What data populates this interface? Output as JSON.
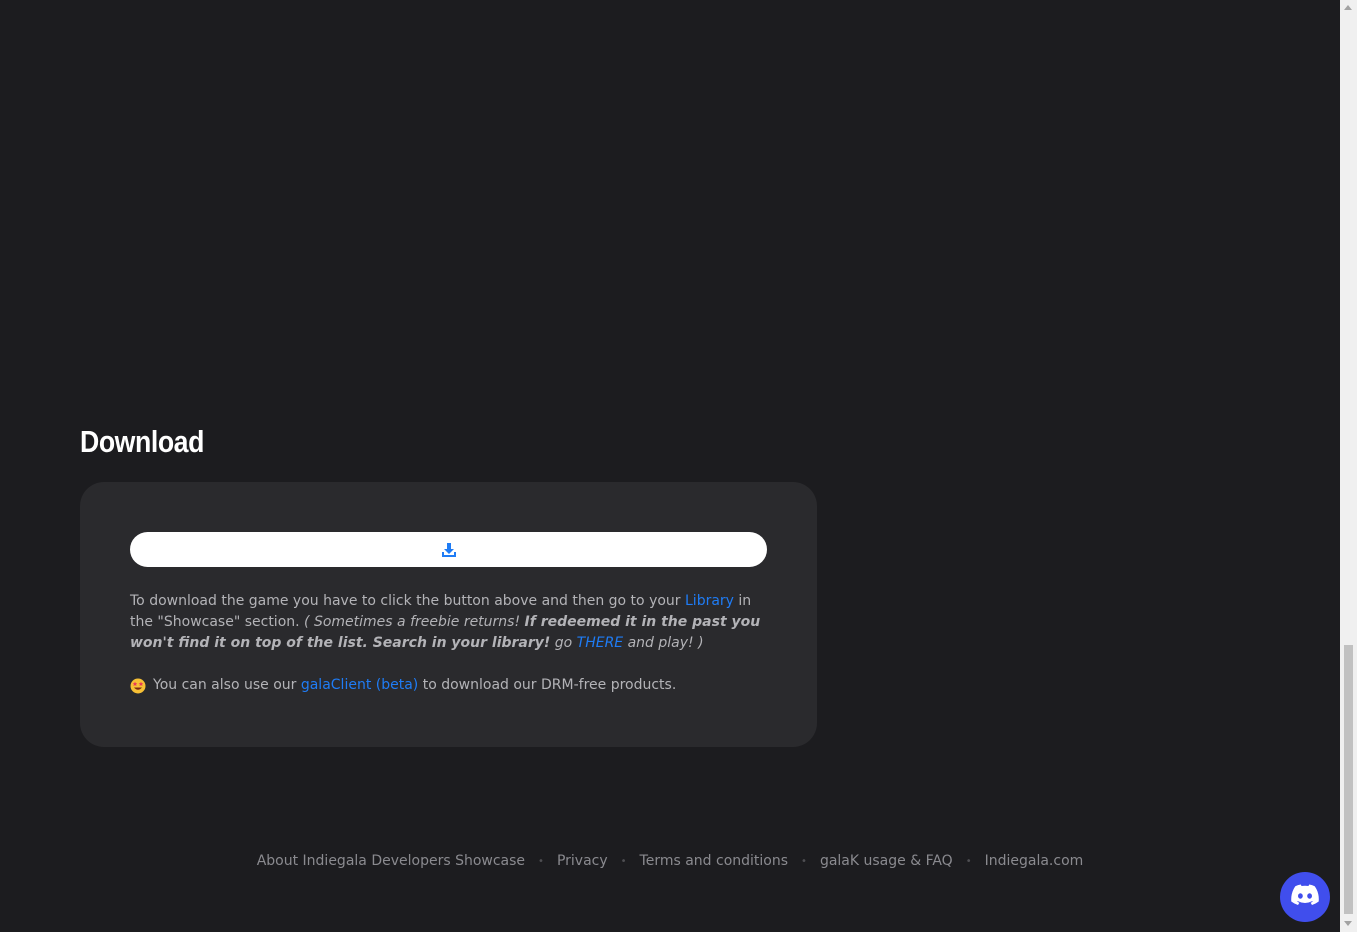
{
  "download": {
    "title": "Download",
    "button_icon": "download-icon",
    "desc_1": "To download the game you have to click the button above and then go to your ",
    "library_link": "Library",
    "desc_2": " in the \"Showcase\" section. ",
    "note_open": "( Sometimes a freebie returns! ",
    "note_bold": "If redeemed it in the past you won't find it on top of the list. Search in your library!",
    "note_go": " go ",
    "there_link": "THERE",
    "note_close": " and play! )",
    "client_emoji": "star-struck-emoji",
    "client_1": "You can also use our ",
    "client_link": "galaClient (beta)",
    "client_2": " to download our DRM-free products."
  },
  "footer": {
    "links": [
      "About Indiegala Developers Showcase",
      "Privacy",
      "Terms and conditions",
      "galaK usage & FAQ",
      "Indiegala.com"
    ],
    "separator": "•"
  },
  "discord": {
    "icon": "discord-icon",
    "color": "#404eed"
  },
  "colors": {
    "background": "#1c1c1f",
    "card": "#2a2a2d",
    "link": "#1f7cf5",
    "text": "#b3b3b7"
  }
}
